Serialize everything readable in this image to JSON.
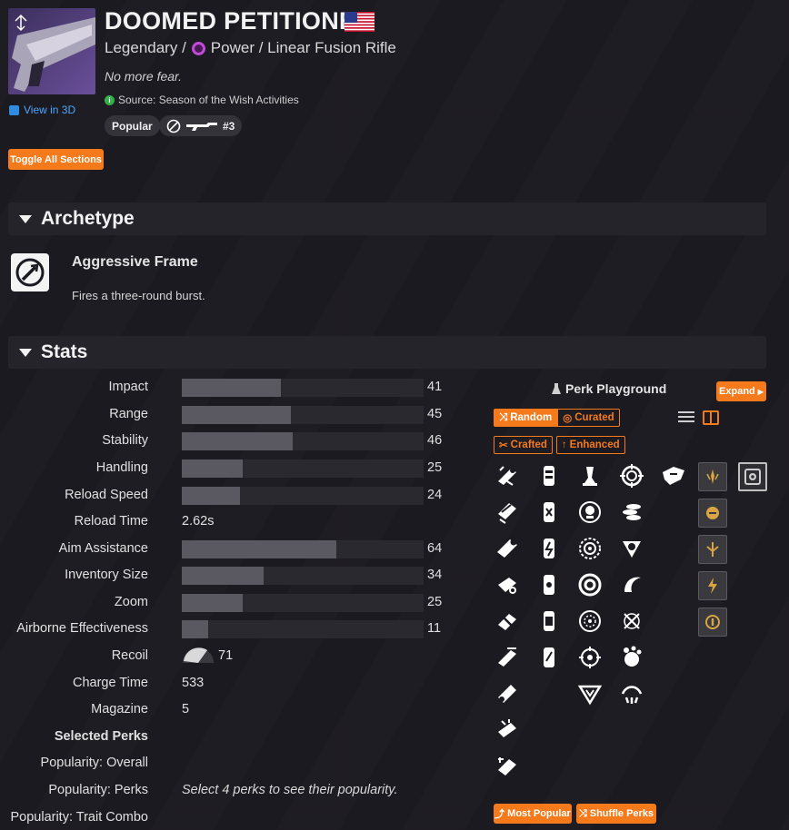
{
  "header": {
    "title": "DOOMED PETITIONER",
    "rarity": "Legendary /",
    "damage_type": "Power / Linear Fusion Rifle",
    "flavor": "No more fear.",
    "source": "Source: Season of the Wish Activities",
    "view_3d": "View in 3D",
    "popular_label": "Popular",
    "rank_label": "#3",
    "toggle_all": "Toggle All Sections"
  },
  "sections": {
    "archetype": "Archetype",
    "stats": "Stats"
  },
  "archetype": {
    "name": "Aggressive Frame",
    "description": "Fires a three-round burst."
  },
  "stats": [
    {
      "label": "Impact",
      "value": "41",
      "bar": 41
    },
    {
      "label": "Range",
      "value": "45",
      "bar": 45
    },
    {
      "label": "Stability",
      "value": "46",
      "bar": 46
    },
    {
      "label": "Handling",
      "value": "25",
      "bar": 25
    },
    {
      "label": "Reload Speed",
      "value": "24",
      "bar": 24
    },
    {
      "label": "Reload Time",
      "value": "2.62s"
    },
    {
      "label": "Aim Assistance",
      "value": "64",
      "bar": 64
    },
    {
      "label": "Inventory Size",
      "value": "34",
      "bar": 34
    },
    {
      "label": "Zoom",
      "value": "25",
      "bar": 25
    },
    {
      "label": "Airborne Effectiveness",
      "value": "11",
      "bar": 11
    },
    {
      "label": "Recoil",
      "value": "71"
    },
    {
      "label": "Charge Time",
      "value": "533"
    },
    {
      "label": "Magazine",
      "value": "5"
    }
  ],
  "perks_info": {
    "selected_perks": "Selected Perks",
    "pop_overall": "Popularity: Overall",
    "pop_perks": "Popularity: Perks",
    "pop_trait": "Popularity: Trait Combo",
    "pop_note": "Select 4 perks to see their popularity."
  },
  "playground": {
    "title": "Perk Playground",
    "expand": "Expand",
    "random": "Random",
    "curated": "Curated",
    "crafted": "Crafted",
    "enhanced": "Enhanced",
    "most_popular": "Most Popular",
    "shuffle": "Shuffle Perks"
  },
  "colors": {
    "accent": "#f47a1b",
    "power": "#c14bd8",
    "link": "#4aa6ff",
    "bar_fill": "#5a5962",
    "bar_track": "#2a2930"
  }
}
